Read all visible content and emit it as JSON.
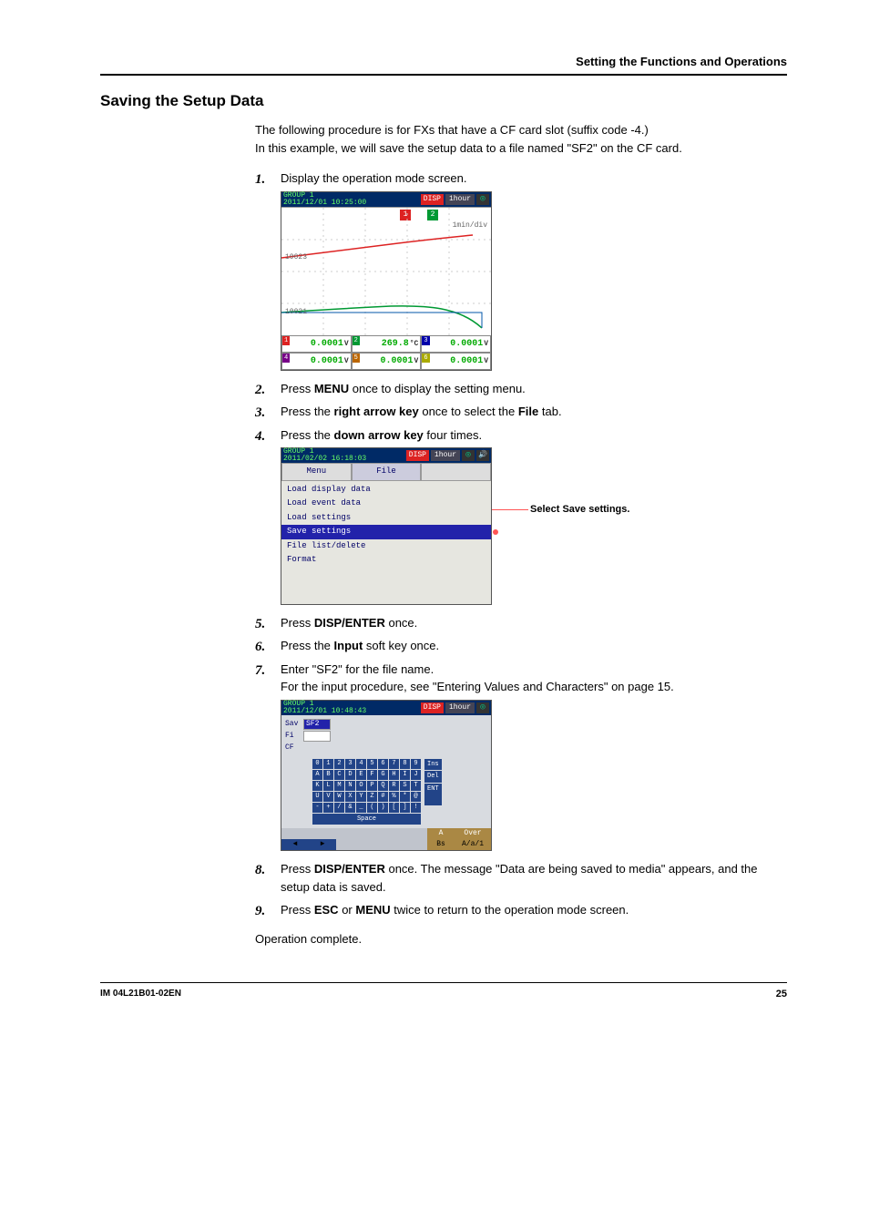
{
  "header": {
    "section": "Setting the Functions and Operations"
  },
  "title": "Saving the Setup Data",
  "intro": {
    "line1": "The following procedure is for FXs that have a CF card slot (suffix code -4.)",
    "line2": "In this example, we will save the setup data to a file named \"SF2\" on the CF card."
  },
  "steps": {
    "s1": {
      "num": "1.",
      "text": "Display the operation mode screen."
    },
    "s2": {
      "num": "2.",
      "pre": "Press ",
      "bold": "MENU",
      "post": " once to display the setting menu."
    },
    "s3": {
      "num": "3.",
      "pre": "Press the ",
      "bold": "right arrow key",
      "mid": " once to select the ",
      "bold2": "File",
      "post": " tab."
    },
    "s4": {
      "num": "4.",
      "pre": "Press the ",
      "bold": "down arrow key",
      "post": " four times."
    },
    "s5": {
      "num": "5.",
      "pre": "Press ",
      "bold": "DISP/ENTER",
      "post": " once."
    },
    "s6": {
      "num": "6.",
      "pre": "Press the ",
      "bold": "Input",
      "post": " soft key once."
    },
    "s7": {
      "num": "7.",
      "text": "Enter \"SF2\" for the file name.",
      "sub": "For the input procedure, see \"Entering Values and Characters\" on page 15."
    },
    "s8": {
      "num": "8.",
      "pre": "Press ",
      "bold": "DISP/ENTER",
      "post": " once. The message \"Data are being saved to media\" appears, and the setup data is saved."
    },
    "s9": {
      "num": "9.",
      "pre": "Press ",
      "bold": "ESC",
      "mid": " or ",
      "bold2": "MENU",
      "post": " twice to return to the operation mode screen."
    }
  },
  "closing": "Operation complete.",
  "screen1": {
    "group": "GROUP 1",
    "datetime": "2011/12/01 10:25:00",
    "disp": "DISP",
    "range_btn": "1hour",
    "tag1": "1",
    "tag2": "2",
    "scale": "1min/div",
    "y1": "10023",
    "y2": "10021",
    "vals": {
      "c1": {
        "idx": "1",
        "v": "0.0001",
        "u": "V"
      },
      "c2": {
        "idx": "2",
        "v": "269.8",
        "u": "°C"
      },
      "c3": {
        "idx": "3",
        "v": "0.0001",
        "u": "V"
      },
      "c4": {
        "idx": "4",
        "v": "0.0001",
        "u": "V"
      },
      "c5": {
        "idx": "5",
        "v": "0.0001",
        "u": "V"
      },
      "c6": {
        "idx": "6",
        "v": "0.0001",
        "u": "V"
      }
    }
  },
  "screen2": {
    "group": "GROUP 1",
    "datetime": "2011/02/02 16:18:03",
    "disp": "DISP",
    "range_btn": "1hour",
    "tab_menu": "Menu",
    "tab_file": "File",
    "items": {
      "i1": "Load display data",
      "i2": "Load event data",
      "i3": "Load settings",
      "i4": "Save settings",
      "i5": "File list/delete",
      "i6": "Format"
    },
    "callout": "Select Save settings."
  },
  "screen3": {
    "group": "GROUP 1",
    "datetime": "2011/12/01 10:48:43",
    "disp": "DISP",
    "range_btn": "1hour",
    "rows": {
      "sav": "Sav",
      "fi": "Fi",
      "cf": "CF"
    },
    "input_value": "SF2",
    "keys_row1": [
      "0",
      "1",
      "2",
      "3",
      "4",
      "5",
      "6",
      "7",
      "8",
      "9"
    ],
    "keys_row2": [
      "A",
      "B",
      "C",
      "D",
      "E",
      "F",
      "G",
      "H",
      "I",
      "J"
    ],
    "keys_row3": [
      "K",
      "L",
      "M",
      "N",
      "O",
      "P",
      "Q",
      "R",
      "S",
      "T"
    ],
    "keys_row4": [
      "U",
      "V",
      "W",
      "X",
      "Y",
      "Z",
      "#",
      "%",
      "*",
      "@"
    ],
    "keys_row5": [
      "-",
      "+",
      "/",
      "&",
      "_",
      "(",
      ")",
      "[",
      "]",
      "!"
    ],
    "side": {
      "ins": "Ins",
      "del": "Del",
      "ent": "ENT"
    },
    "space": "Space",
    "soft": {
      "a": "A",
      "over": "Over",
      "bs": "Bs",
      "mode": "A/a/1"
    },
    "arrows": {
      "left": "◄",
      "right": "►"
    }
  },
  "footer": {
    "doc": "IM 04L21B01-02EN",
    "page": "25"
  }
}
